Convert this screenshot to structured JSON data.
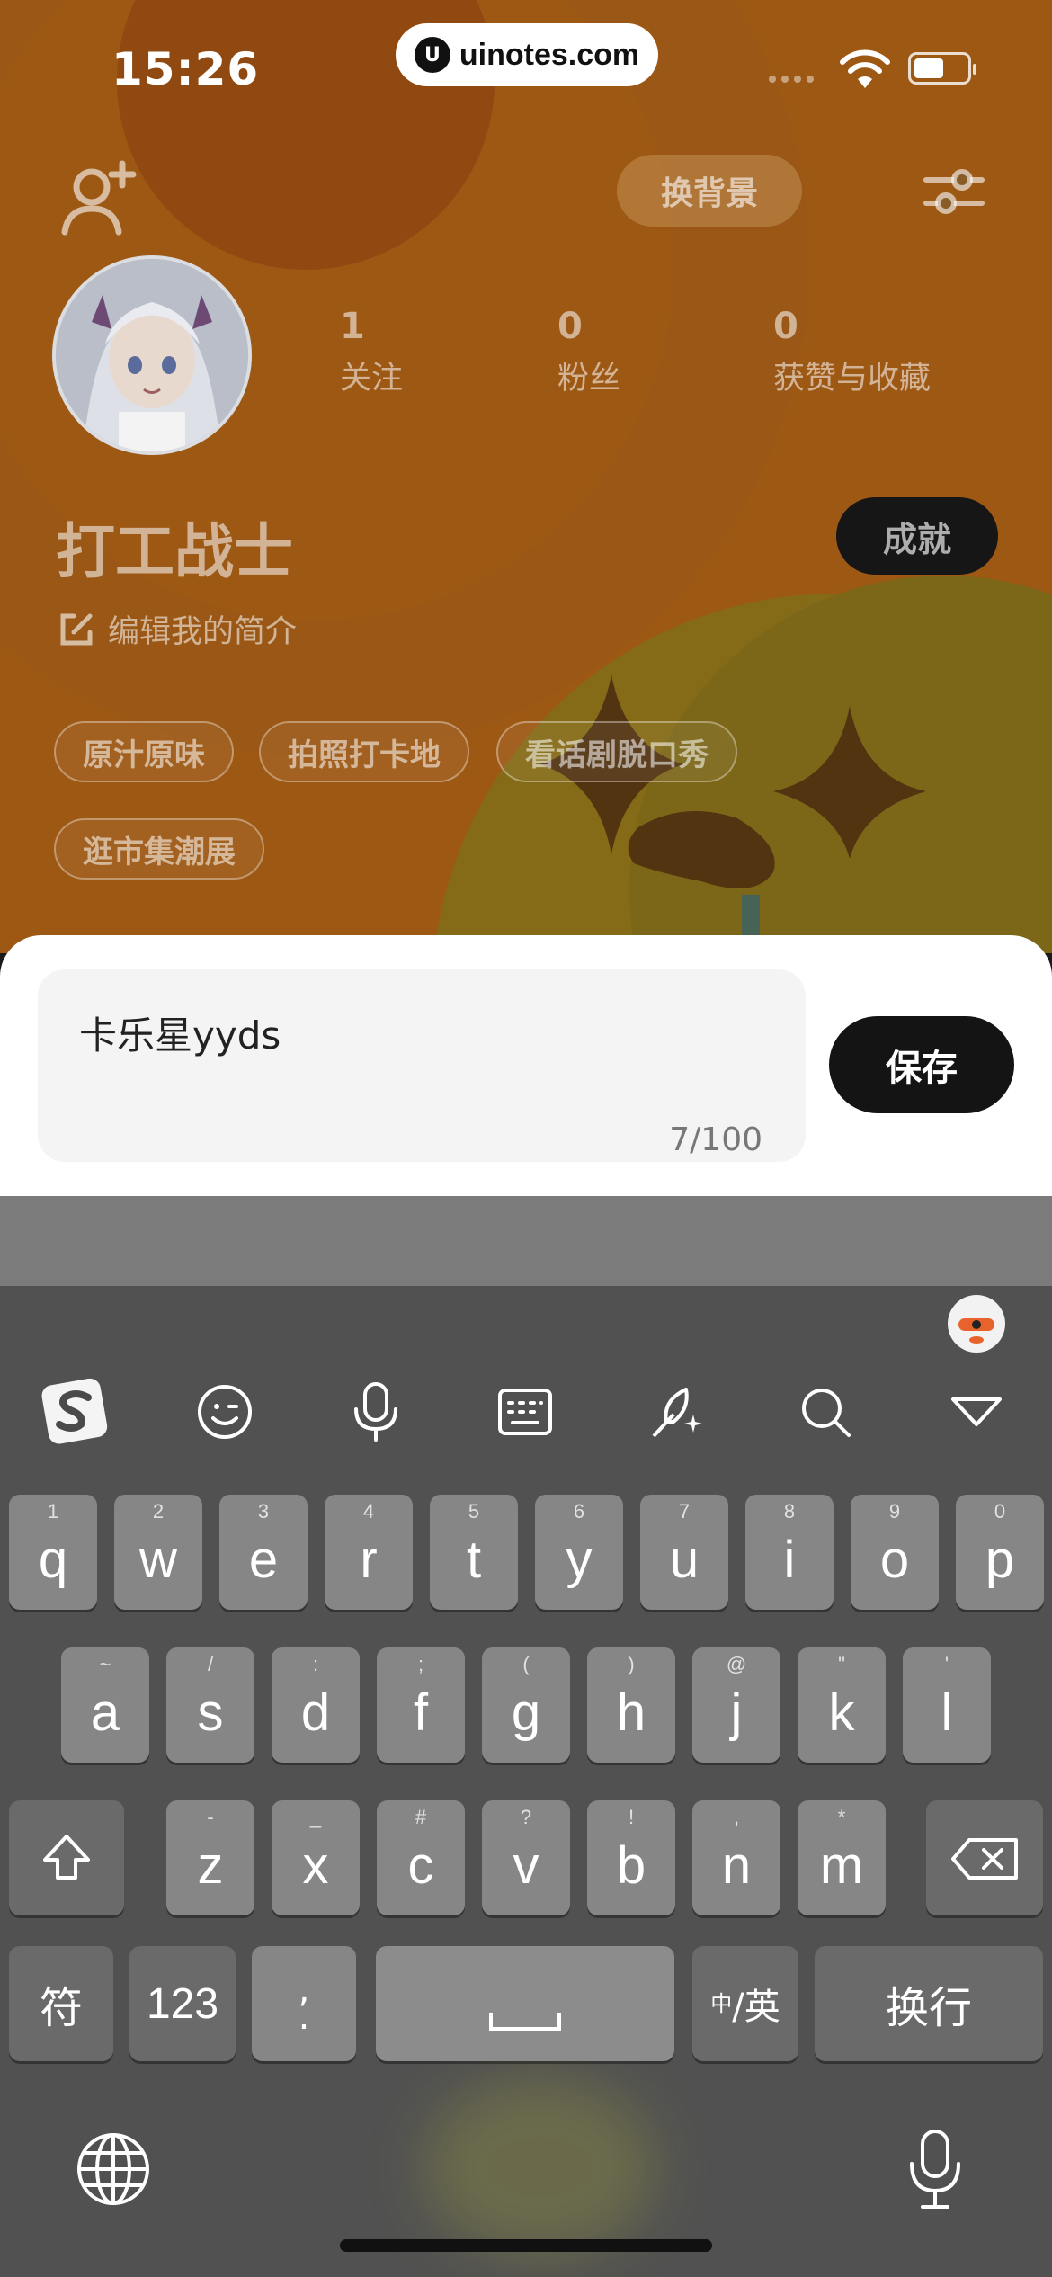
{
  "status_bar": {
    "time": "15:26",
    "url": "uinotes.com"
  },
  "header": {
    "change_background": "换背景"
  },
  "profile": {
    "stats": [
      {
        "num": "1",
        "label": "关注"
      },
      {
        "num": "0",
        "label": "粉丝"
      },
      {
        "num": "0",
        "label": "获赞与收藏"
      }
    ],
    "username": "打工战士",
    "achievement": "成就",
    "edit_bio": "编辑我的简介",
    "tags": [
      "原汁原味",
      "拍照打卡地",
      "看话剧脱口秀",
      "逛市集潮展"
    ]
  },
  "bio_editor": {
    "text": "卡乐星yyds",
    "counter": "7/100",
    "save": "保存"
  },
  "keyboard": {
    "row1": [
      {
        "k": "q",
        "s": "1"
      },
      {
        "k": "w",
        "s": "2"
      },
      {
        "k": "e",
        "s": "3"
      },
      {
        "k": "r",
        "s": "4"
      },
      {
        "k": "t",
        "s": "5"
      },
      {
        "k": "y",
        "s": "6"
      },
      {
        "k": "u",
        "s": "7"
      },
      {
        "k": "i",
        "s": "8"
      },
      {
        "k": "o",
        "s": "9"
      },
      {
        "k": "p",
        "s": "0"
      }
    ],
    "row2": [
      {
        "k": "a",
        "s": "~"
      },
      {
        "k": "s",
        "s": "/"
      },
      {
        "k": "d",
        "s": ":"
      },
      {
        "k": "f",
        "s": ";"
      },
      {
        "k": "g",
        "s": "("
      },
      {
        "k": "h",
        "s": ")"
      },
      {
        "k": "j",
        "s": "@"
      },
      {
        "k": "k",
        "s": "\""
      },
      {
        "k": "l",
        "s": "'"
      }
    ],
    "row3": [
      {
        "k": "z",
        "s": "-"
      },
      {
        "k": "x",
        "s": "_"
      },
      {
        "k": "c",
        "s": "#"
      },
      {
        "k": "v",
        "s": "?"
      },
      {
        "k": "b",
        "s": "!"
      },
      {
        "k": "n",
        "s": ","
      },
      {
        "k": "m",
        "s": "*"
      }
    ],
    "symbols": "符",
    "numbers": "123",
    "punct": {
      "top": ",",
      "bottom": "."
    },
    "lang_small": "中",
    "lang_big": "/英",
    "enter": "换行"
  }
}
